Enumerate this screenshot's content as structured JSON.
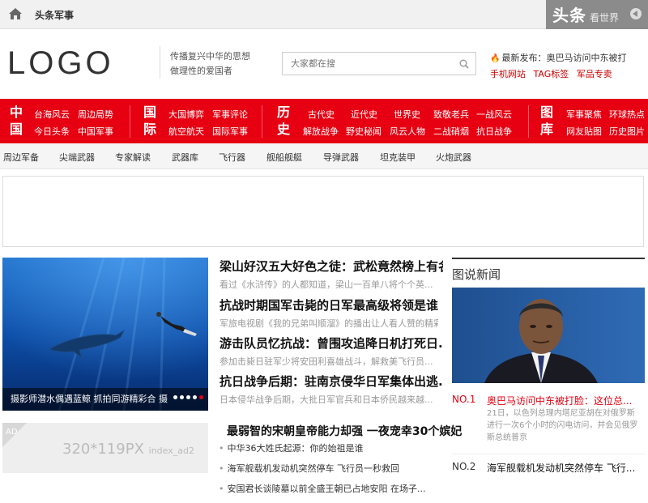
{
  "topbar": {
    "site_name": "头条军事",
    "brand_big": "头条",
    "brand_small": "看世界"
  },
  "header": {
    "logo": "LOGO",
    "slogan_line1": "传播复兴中华的思想",
    "slogan_line2": "做理性的爱国者",
    "search_placeholder": "大家都在搜",
    "latest": "最新发布：奥巴马访问中东被打",
    "links": [
      "手机网站",
      "TAG标签",
      "军品专卖"
    ]
  },
  "rednav": {
    "groups": [
      {
        "title": "中国",
        "items": [
          "台海风云",
          "周边局势",
          "今日头条",
          "中国军事"
        ]
      },
      {
        "title": "国际",
        "items": [
          "大国博弈",
          "军事评论",
          "航空航天",
          "国际军事"
        ]
      },
      {
        "title": "历史",
        "items": [
          "古代史",
          "近代史",
          "世界史",
          "致敬老兵",
          "一战风云",
          "解放战争",
          "野史秘闻",
          "风云人物",
          "二战硝烟",
          "抗日战争"
        ]
      },
      {
        "title": "图库",
        "items": [
          "军事聚焦",
          "环球热点",
          "网友贴图",
          "历史图片"
        ]
      }
    ]
  },
  "subnav": [
    "周边军备",
    "尖端武器",
    "专家解读",
    "武器库",
    "飞行器",
    "舰船舰艇",
    "导弹武器",
    "坦克装甲",
    "火炮武器"
  ],
  "slider": {
    "caption": "摄影师潜水偶遇蓝鲸 抓拍同游精彩合 摄"
  },
  "center_news": [
    {
      "title": "梁山好汉五大好色之徒：武松竟然榜上有名",
      "desc": "看过《水浒传》的人都知道，梁山一百单八将个个英..."
    },
    {
      "title": "抗战时期国军击毙的日军最高级将领是谁",
      "desc": "军旅电视剧《我的兄弟叫顺溜》的播出让人看人赞的精彩..."
    },
    {
      "title": "游击队员忆抗战：曾围攻追降日机打死日...",
      "desc": "参加击毙日驻军少将安田利喜雄战斗，解救美飞行员..."
    },
    {
      "title": "抗日战争后期：驻南京侵华日军集体出逃...",
      "desc": "日本侵华战争后期，大批日军官兵和日本侨民越来越..."
    }
  ],
  "ad2": {
    "tag": "AD",
    "label": "320*119PX",
    "code": "index_ad2"
  },
  "big_news": "最弱智的宋朝皇帝能力却强 一夜宠幸30个嫔妃",
  "list": [
    "中华36大姓氏起源：你的始祖是谁",
    "海军舰载机发动机突然停车 飞行员一秒救回",
    "安国君长谈陵墓以前全盛王朝已占地安阳 在场子..."
  ],
  "right": {
    "title": "图说新闻",
    "rank1": {
      "no": "NO.1",
      "title": "奥巴马访问中东被打脸：这位总...",
      "desc": "21日，以色列总理内塔尼亚胡在对俄罗斯进行一次6个小时的闪电访问，并会见俄罗斯总统普京"
    },
    "rank2": {
      "no": "NO.2",
      "title": "海军舰载机发动机突然停车 飞行..."
    }
  },
  "colors": {
    "accent": "#e60012",
    "topbar": "#f1f1f1",
    "brand_box": "#8b8b8b"
  },
  "icons": [
    "home-icon",
    "search-icon",
    "flame-icon",
    "arrow-left-icon"
  ]
}
